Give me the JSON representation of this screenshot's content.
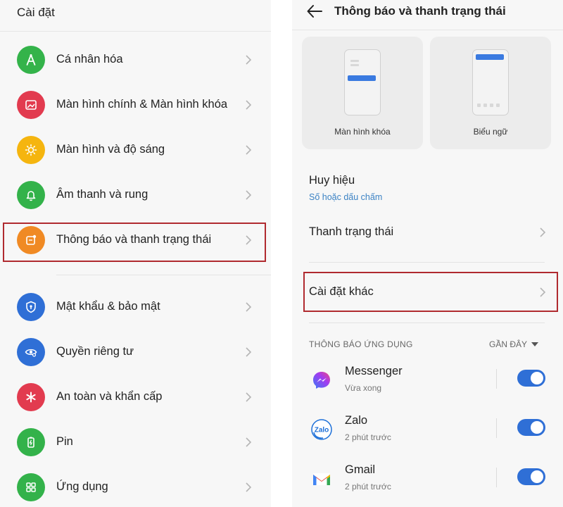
{
  "left": {
    "title": "Cài đặt",
    "items": [
      {
        "label": "Cá nhân hóa",
        "icon": "personalize-icon",
        "color": "#34b34a"
      },
      {
        "label": "Màn hình chính & Màn hình khóa",
        "icon": "wallpaper-icon",
        "color": "#e23b4f"
      },
      {
        "label": "Màn hình và độ sáng",
        "icon": "brightness-icon",
        "color": "#f5b50f"
      },
      {
        "label": "Âm thanh và rung",
        "icon": "bell-icon",
        "color": "#33b24a"
      },
      {
        "label": "Thông báo và thanh trạng thái",
        "icon": "notification-icon",
        "color": "#f08a24"
      },
      {
        "label": "Mật khẩu & bảo mật",
        "icon": "shield-icon",
        "color": "#2f6fd6"
      },
      {
        "label": "Quyền riêng tư",
        "icon": "eye-icon",
        "color": "#2f6fd6"
      },
      {
        "label": "An toàn và khẩn cấp",
        "icon": "asterisk-icon",
        "color": "#e23b4f"
      },
      {
        "label": "Pin",
        "icon": "battery-icon",
        "color": "#33b24a"
      },
      {
        "label": "Ứng dụng",
        "icon": "apps-grid-icon",
        "color": "#33b24a"
      }
    ]
  },
  "right": {
    "title": "Thông báo và thanh trạng thái",
    "cards": [
      {
        "label": "Màn hình khóa"
      },
      {
        "label": "Biểu ngữ"
      }
    ],
    "badge": {
      "title": "Huy hiệu",
      "value": "Số hoặc dấu chấm"
    },
    "status_bar": {
      "title": "Thanh trạng thái"
    },
    "other_settings": {
      "title": "Cài đặt khác"
    },
    "section": {
      "heading": "THÔNG BÁO ỨNG DỤNG",
      "sort": "GẦN ĐÂY"
    },
    "apps": [
      {
        "name": "Messenger",
        "time": "Vừa xong",
        "enabled": true
      },
      {
        "name": "Zalo",
        "time": "2 phút trước",
        "enabled": true
      },
      {
        "name": "Gmail",
        "time": "2 phút trước",
        "enabled": true
      }
    ]
  },
  "colors": {
    "accent": "#2f6fd6",
    "highlight": "#b02a2f"
  }
}
